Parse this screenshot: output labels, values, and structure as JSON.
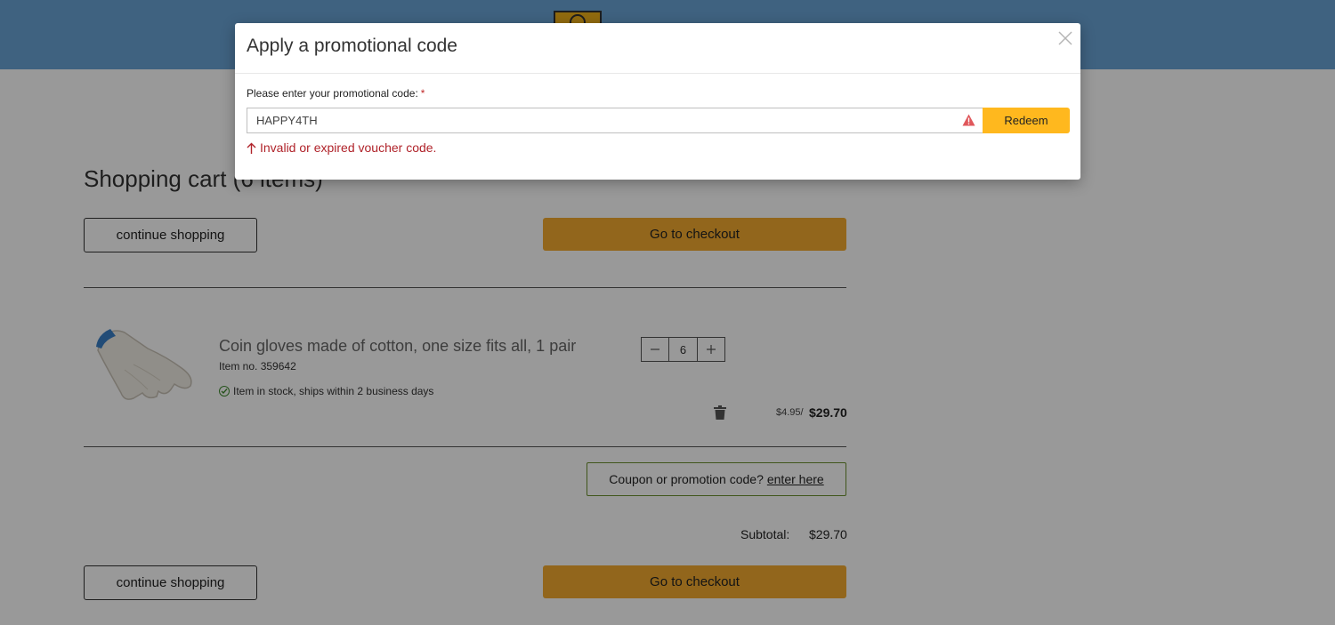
{
  "cart": {
    "title": "Shopping cart (6 items)",
    "continue_label": "continue shopping",
    "checkout_label": "Go to checkout",
    "item": {
      "name": "Coin gloves made of cotton, one size fits all, 1 pair",
      "sku_label": "Item no.",
      "sku_value": "359642",
      "stock": "Item in stock, ships within 2 business days",
      "quantity": "6",
      "unit_price": "$4.95/",
      "total_price": "$29.70"
    },
    "coupon_prompt": "Coupon or promotion code?",
    "coupon_link": "enter here",
    "subtotal_label": "Subtotal:",
    "subtotal_value": "$29.70"
  },
  "modal": {
    "title": "Apply a promotional code",
    "field_label": "Please enter your promotional code:",
    "required_mark": "*",
    "code_value": "HAPPY4TH",
    "redeem_label": "Redeem",
    "error": "Invalid or expired voucher code."
  },
  "icons": {
    "close": "close-icon",
    "warning": "warning-icon",
    "error_arrow": "arrow-up-icon",
    "stock": "check-circle-icon",
    "trash": "trash-icon",
    "minus": "minus-icon",
    "plus": "plus-icon"
  },
  "colors": {
    "header": "#6aa4d6",
    "checkout": "#f3ab2f",
    "redeem": "#ffb81e",
    "error": "#b0232a",
    "coupon_border": "#6b8f2e"
  }
}
